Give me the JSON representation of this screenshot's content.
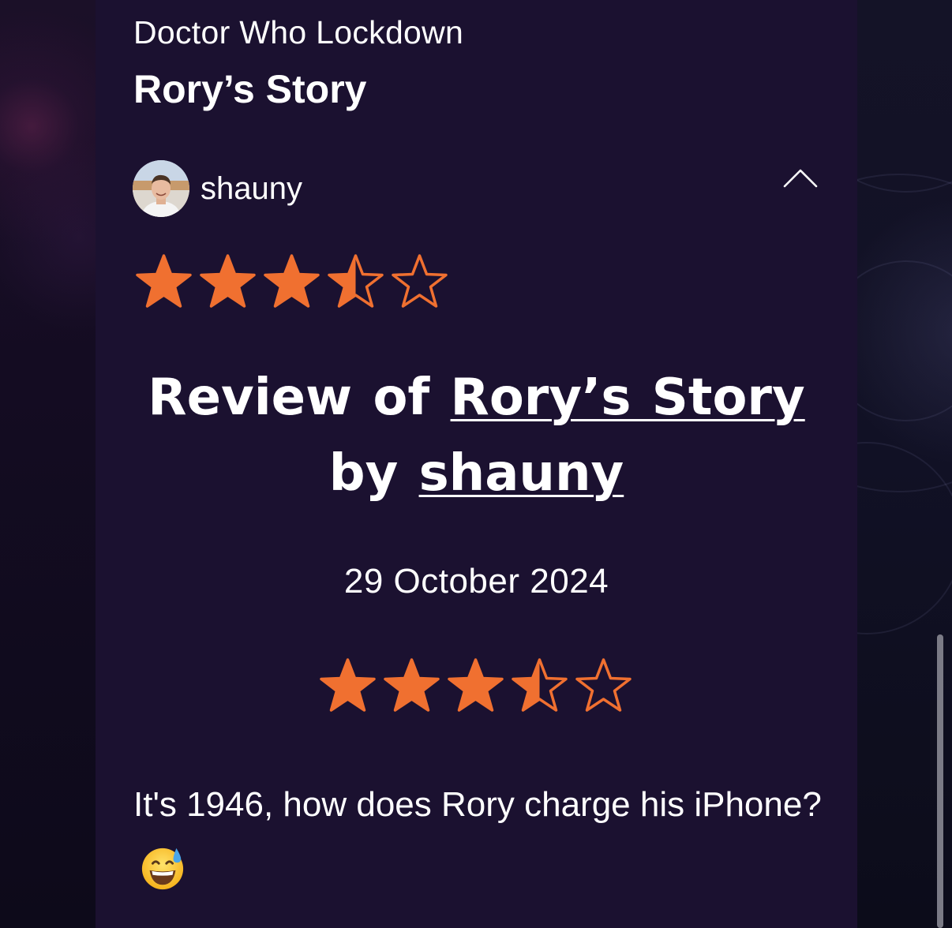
{
  "header": {
    "category": "Doctor Who Lockdown",
    "title": "Rory’s Story"
  },
  "author": {
    "name": "shauny",
    "avatar_icon": "user-avatar"
  },
  "rating": {
    "value": 3.5,
    "max": 5,
    "color": "#f07030"
  },
  "review": {
    "heading_prefix": "Review of",
    "story_link": "Rory’s Story",
    "heading_by": "by",
    "author_link": "shauny",
    "date": "29 October 2024",
    "body": "It's 1946, how does Rory charge his iPhone?",
    "emoji": "grinning-face-with-sweat"
  },
  "colors": {
    "panel_bg": "#1b1130",
    "accent": "#f07030",
    "text": "#ffffff"
  }
}
